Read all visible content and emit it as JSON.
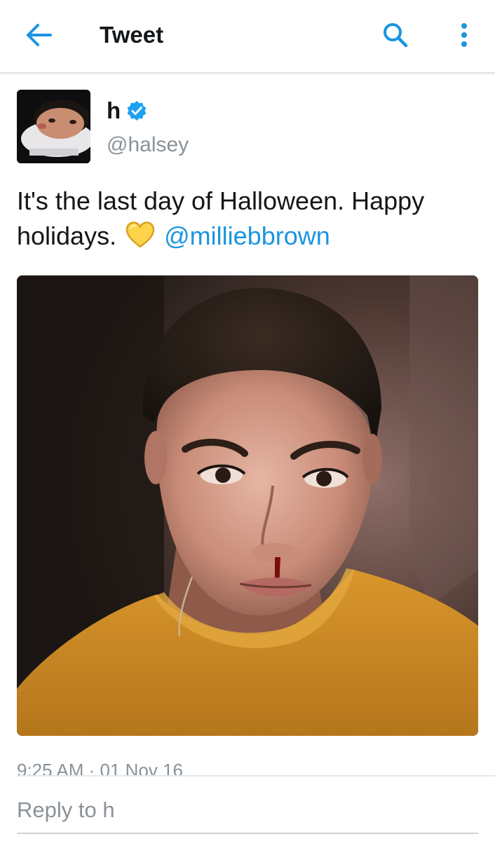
{
  "header": {
    "title": "Tweet",
    "back_icon": "arrow-left-icon",
    "search_icon": "search-icon",
    "more_icon": "more-vertical-icon",
    "accent_color": "#1b95e0"
  },
  "tweet": {
    "author": {
      "display_name": "h",
      "handle": "@halsey",
      "verified": true
    },
    "text_before": "It's the last day of Halloween. Happy holidays.",
    "emoji": "yellow-heart",
    "mention": "@milliebbrown",
    "photo_icon": "selfie-photo",
    "timestamp": "9:25 AM · 01 Nov 16"
  },
  "reply": {
    "placeholder": "Reply to h"
  }
}
